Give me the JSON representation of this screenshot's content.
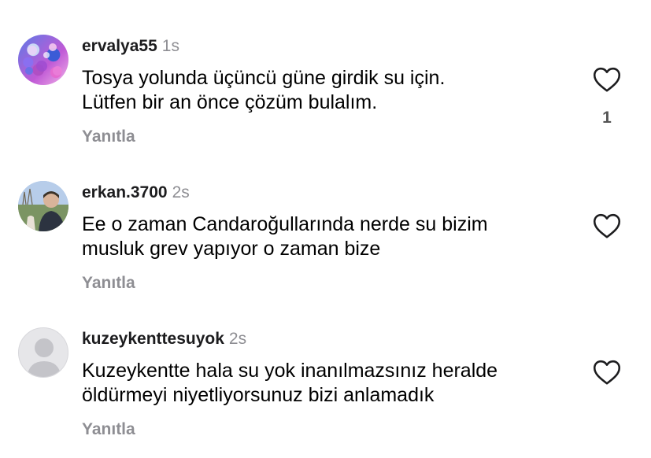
{
  "comments": [
    {
      "username": "ervalya55",
      "time": "1s",
      "text_lines": [
        "Tosya yolunda üçüncü güne girdik su için.",
        "Lütfen bir an önce çözüm bulalım."
      ],
      "reply_label": "Yanıtla",
      "like_count": "1",
      "avatar_icon": "flowers-avatar"
    },
    {
      "username": "erkan.3700",
      "time": "2s",
      "text_lines": [
        "Ee o zaman Candaroğullarında nerde su bizim",
        "musluk grev yapıyor o zaman bize"
      ],
      "reply_label": "Yanıtla",
      "avatar_icon": "photo-avatar"
    },
    {
      "username": "kuzeykenttesuyok",
      "time": "2s",
      "text_lines": [
        "Kuzeykentte hala su yok inanılmazsınız heralde",
        "öldürmeyi niyetliyorsunuz bizi anlamadık"
      ],
      "reply_label": "Yanıtla",
      "avatar_icon": "default-avatar"
    }
  ],
  "colors": {
    "secondary_text": "#8e8e93",
    "heart_stroke": "#1c1c1e"
  }
}
